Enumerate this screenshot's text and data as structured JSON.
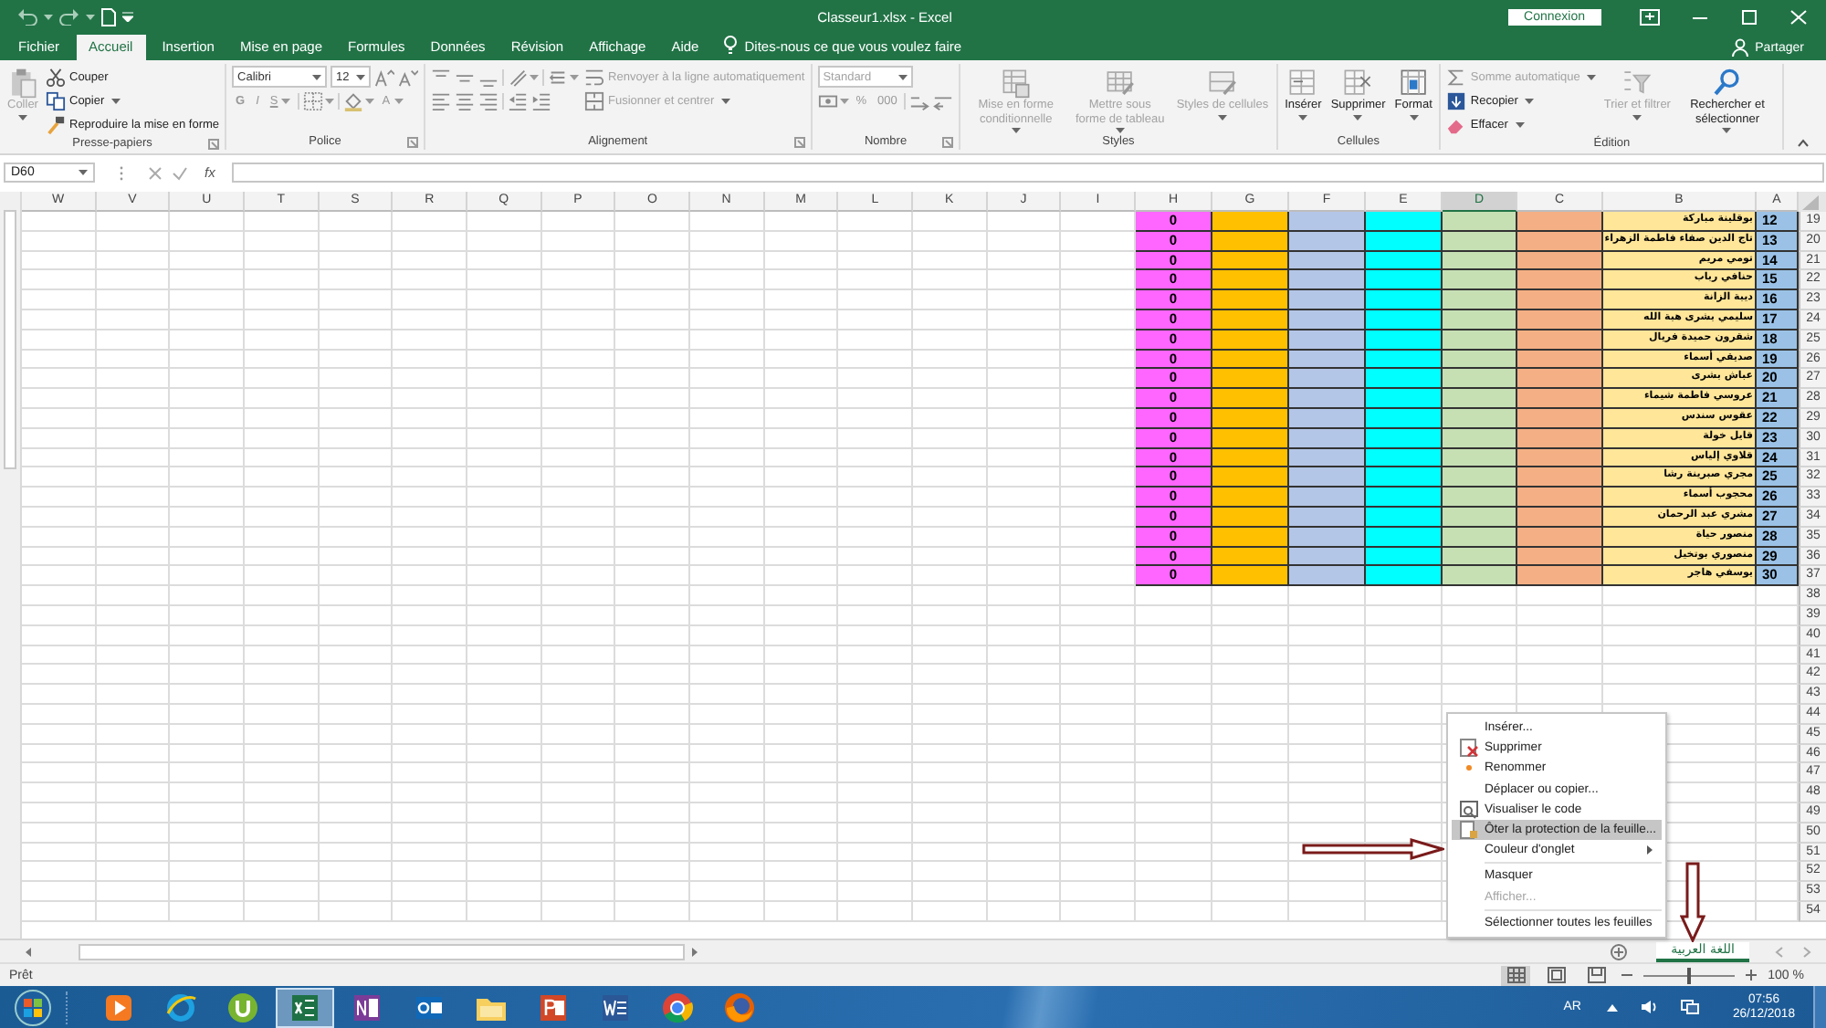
{
  "window": {
    "title": "Classeur1.xlsx - Excel",
    "signin": "Connexion"
  },
  "ribbon_tabs": [
    {
      "label": "Fichier",
      "selected": false
    },
    {
      "label": "Accueil",
      "selected": true
    },
    {
      "label": "Insertion",
      "selected": false
    },
    {
      "label": "Mise en page",
      "selected": false
    },
    {
      "label": "Formules",
      "selected": false
    },
    {
      "label": "Données",
      "selected": false
    },
    {
      "label": "Révision",
      "selected": false
    },
    {
      "label": "Affichage",
      "selected": false
    },
    {
      "label": "Aide",
      "selected": false
    }
  ],
  "tell_me": "Dites-nous ce que vous voulez faire",
  "share": "Partager",
  "ribbon_groups": [
    {
      "label": "Presse-papiers",
      "controls": [
        {
          "kind": "large",
          "label": "Coller",
          "disabled": true
        },
        {
          "kind": "button",
          "label": "Couper",
          "disabled": false
        },
        {
          "kind": "button",
          "label": "Copier",
          "disabled": false
        },
        {
          "kind": "button",
          "label": "Reproduire la mise en forme",
          "disabled": false
        }
      ]
    },
    {
      "label": "Police",
      "controls": [
        {
          "kind": "combo",
          "value": "Calibri",
          "disabled": false
        },
        {
          "kind": "combo",
          "value": "12",
          "disabled": false
        },
        {
          "kind": "glyph",
          "label": "G",
          "disabled": true
        },
        {
          "kind": "glyph",
          "label": "I",
          "disabled": true
        },
        {
          "kind": "glyph",
          "label": "S",
          "disabled": true
        },
        {
          "kind": "glyph",
          "label": "A",
          "disabled": true
        }
      ]
    },
    {
      "label": "Alignement",
      "controls": [
        {
          "kind": "button",
          "label": "Renvoyer à la ligne automatiquement",
          "disabled": true
        },
        {
          "kind": "button",
          "label": "Fusionner et centrer",
          "disabled": true
        }
      ]
    },
    {
      "label": "Nombre",
      "controls": [
        {
          "kind": "combo",
          "value": "Standard",
          "disabled": true
        },
        {
          "kind": "glyph",
          "label": "%",
          "disabled": true
        },
        {
          "kind": "glyph",
          "label": "000",
          "disabled": true
        }
      ]
    },
    {
      "label": "Styles",
      "controls": [
        {
          "kind": "large",
          "label": "Mise en forme conditionnelle",
          "disabled": true
        },
        {
          "kind": "large",
          "label": "Mettre sous forme de tableau",
          "disabled": true
        },
        {
          "kind": "large",
          "label": "Styles de cellules",
          "disabled": true
        }
      ]
    },
    {
      "label": "Cellules",
      "controls": [
        {
          "kind": "large",
          "label": "Insérer",
          "disabled": false
        },
        {
          "kind": "large",
          "label": "Supprimer",
          "disabled": false
        },
        {
          "kind": "large",
          "label": "Format",
          "disabled": false
        }
      ]
    },
    {
      "label": "Édition",
      "controls": [
        {
          "kind": "button",
          "label": "Somme automatique",
          "disabled": true
        },
        {
          "kind": "button",
          "label": "Recopier",
          "disabled": false
        },
        {
          "kind": "button",
          "label": "Effacer",
          "disabled": false
        },
        {
          "kind": "large",
          "label": "Trier et filtrer",
          "disabled": true
        },
        {
          "kind": "large",
          "label": "Rechercher et sélectionner",
          "disabled": false
        }
      ]
    }
  ],
  "formula_bar": {
    "name_box": "D60",
    "function_label": "fx"
  },
  "sheet": {
    "columns": [
      {
        "label": "W",
        "selected": false
      },
      {
        "label": "V",
        "selected": false
      },
      {
        "label": "U",
        "selected": false
      },
      {
        "label": "T",
        "selected": false
      },
      {
        "label": "S",
        "selected": false
      },
      {
        "label": "R",
        "selected": false
      },
      {
        "label": "Q",
        "selected": false
      },
      {
        "label": "P",
        "selected": false
      },
      {
        "label": "O",
        "selected": false
      },
      {
        "label": "N",
        "selected": false
      },
      {
        "label": "M",
        "selected": false
      },
      {
        "label": "L",
        "selected": false
      },
      {
        "label": "K",
        "selected": false
      },
      {
        "label": "J",
        "selected": false
      },
      {
        "label": "I",
        "selected": false
      },
      {
        "label": "H",
        "selected": false,
        "color": "#ff66ff"
      },
      {
        "label": "G",
        "selected": false,
        "color": "#ffc000"
      },
      {
        "label": "F",
        "selected": false,
        "color": "#b4c6e7"
      },
      {
        "label": "E",
        "selected": false,
        "color": "#00ffff"
      },
      {
        "label": "D",
        "selected": true,
        "color": "#c6e0b4"
      },
      {
        "label": "C",
        "selected": false,
        "color": "#f4b084"
      },
      {
        "label": "B",
        "selected": false,
        "color": "#ffe699"
      },
      {
        "label": "A",
        "selected": false,
        "color": "#9bc2e6"
      }
    ],
    "rows": [
      {
        "number": "19",
        "cells": {
          "A": "12",
          "B": "بوقلينة مباركة",
          "H": "0"
        }
      },
      {
        "number": "20",
        "cells": {
          "A": "13",
          "B": "تاج الدين صفاء فاطمة الزهراء",
          "H": "0"
        }
      },
      {
        "number": "21",
        "cells": {
          "A": "14",
          "B": "تومي مريم",
          "H": "0"
        }
      },
      {
        "number": "22",
        "cells": {
          "A": "15",
          "B": "حنافي رباب",
          "H": "0"
        }
      },
      {
        "number": "23",
        "cells": {
          "A": "16",
          "B": "ديبة الزانة",
          "H": "0"
        }
      },
      {
        "number": "24",
        "cells": {
          "A": "17",
          "B": "سليمي بشرى هبة الله",
          "H": "0"
        }
      },
      {
        "number": "25",
        "cells": {
          "A": "18",
          "B": "شقرون حميدة فريال",
          "H": "0"
        }
      },
      {
        "number": "26",
        "cells": {
          "A": "19",
          "B": "صديقي أسماء",
          "H": "0"
        }
      },
      {
        "number": "27",
        "cells": {
          "A": "20",
          "B": "عباش بشرى",
          "H": "0"
        }
      },
      {
        "number": "28",
        "cells": {
          "A": "21",
          "B": "عروسي فاطمة شيماء",
          "H": "0"
        }
      },
      {
        "number": "29",
        "cells": {
          "A": "22",
          "B": "عقوس سندس",
          "H": "0"
        }
      },
      {
        "number": "30",
        "cells": {
          "A": "23",
          "B": "قايل خولة",
          "H": "0"
        }
      },
      {
        "number": "31",
        "cells": {
          "A": "24",
          "B": "قلاوي إلياس",
          "H": "0"
        }
      },
      {
        "number": "32",
        "cells": {
          "A": "25",
          "B": "مجري صبرينة رشا",
          "H": "0"
        }
      },
      {
        "number": "33",
        "cells": {
          "A": "26",
          "B": "محجوب أسماء",
          "H": "0"
        }
      },
      {
        "number": "34",
        "cells": {
          "A": "27",
          "B": "مشري عبد الرحمان",
          "H": "0"
        }
      },
      {
        "number": "35",
        "cells": {
          "A": "28",
          "B": "منصور حياة",
          "H": "0"
        }
      },
      {
        "number": "36",
        "cells": {
          "A": "29",
          "B": "منصوري بوتخيل",
          "H": "0"
        }
      },
      {
        "number": "37",
        "cells": {
          "A": "30",
          "B": "يوسفي هاجر",
          "H": "0"
        }
      },
      {
        "number": "38"
      },
      {
        "number": "39"
      },
      {
        "number": "40"
      },
      {
        "number": "41"
      },
      {
        "number": "42"
      },
      {
        "number": "43"
      },
      {
        "number": "44"
      },
      {
        "number": "45"
      },
      {
        "number": "46"
      },
      {
        "number": "47"
      },
      {
        "number": "48"
      },
      {
        "number": "49"
      },
      {
        "number": "50"
      },
      {
        "number": "51"
      },
      {
        "number": "52"
      },
      {
        "number": "53"
      },
      {
        "number": "54"
      }
    ]
  },
  "sheet_tabs": [
    {
      "label": "اللغة العربية",
      "selected": true
    }
  ],
  "context_menu": [
    {
      "kind": "plain",
      "label": "Insérer...",
      "selected": false,
      "disabled": false
    },
    {
      "kind": "delete",
      "label": "Supprimer",
      "selected": false,
      "disabled": false
    },
    {
      "kind": "rename",
      "label": "Renommer",
      "selected": false,
      "disabled": false
    },
    {
      "kind": "plain",
      "label": "Déplacer ou copier...",
      "selected": false,
      "disabled": false
    },
    {
      "kind": "code",
      "label": "Visualiser le code",
      "selected": false,
      "disabled": false
    },
    {
      "kind": "protect",
      "label": "Ôter la protection de la feuille...",
      "selected": true,
      "disabled": false
    },
    {
      "kind": "submenu",
      "label": "Couleur d'onglet",
      "selected": false,
      "disabled": false
    },
    {
      "kind": "separator"
    },
    {
      "kind": "plain",
      "label": "Masquer",
      "selected": false,
      "disabled": false
    },
    {
      "kind": "plain",
      "label": "Afficher...",
      "selected": false,
      "disabled": true
    },
    {
      "kind": "separator"
    },
    {
      "kind": "plain",
      "label": "Sélectionner toutes les feuilles",
      "selected": false,
      "disabled": false
    }
  ],
  "status_bar": {
    "text": "Prêt",
    "views": [
      {
        "kind": "normal",
        "selected": true
      },
      {
        "kind": "layout",
        "selected": false
      },
      {
        "kind": "pagebreak",
        "selected": false
      }
    ],
    "zoom": {
      "level": 0.5,
      "reading": "100 %"
    }
  },
  "taskbar": {
    "apps": [
      {
        "kind": "media",
        "selected": false
      },
      {
        "kind": "ie",
        "selected": false
      },
      {
        "kind": "torrent",
        "selected": false
      },
      {
        "kind": "excel",
        "selected": true
      },
      {
        "kind": "onenote",
        "selected": false
      },
      {
        "kind": "outlook",
        "selected": false
      },
      {
        "kind": "explorer",
        "selected": false
      },
      {
        "kind": "powerpoint",
        "selected": false
      },
      {
        "kind": "word",
        "selected": false
      },
      {
        "kind": "chrome",
        "selected": false
      },
      {
        "kind": "firefox",
        "selected": false
      }
    ],
    "language": "AR",
    "time": "07:56",
    "date": "26/12/2018"
  }
}
